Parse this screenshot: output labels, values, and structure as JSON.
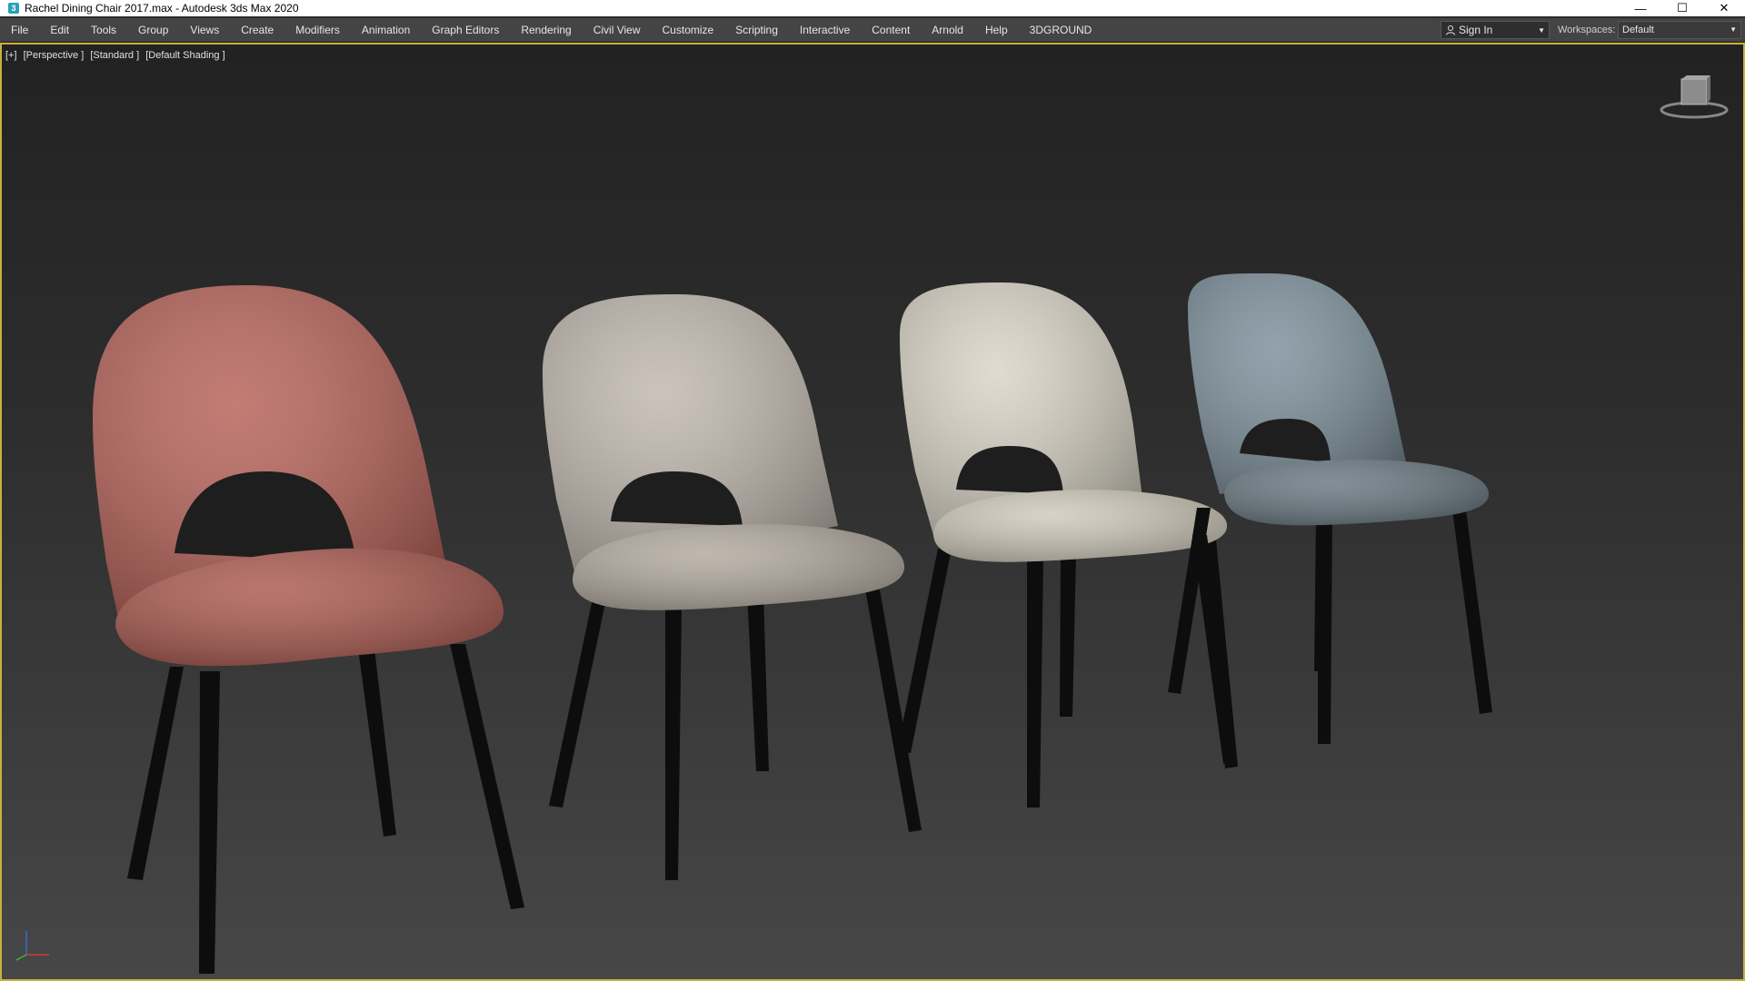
{
  "window": {
    "app_icon_glyph": "3",
    "title": "Rachel Dining Chair 2017.max - Autodesk 3ds Max 2020",
    "controls": {
      "minimize": "—",
      "maximize": "☐",
      "close": "✕"
    }
  },
  "menu": {
    "items": [
      "File",
      "Edit",
      "Tools",
      "Group",
      "Views",
      "Create",
      "Modifiers",
      "Animation",
      "Graph Editors",
      "Rendering",
      "Civil View",
      "Customize",
      "Scripting",
      "Interactive",
      "Content",
      "Arnold",
      "Help",
      "3DGROUND"
    ],
    "sign_in": "Sign In",
    "workspaces_label": "Workspaces:",
    "workspace_value": "Default"
  },
  "viewport": {
    "labels": [
      "[+]",
      "[Perspective ]",
      "[Standard ]",
      "[Default Shading ]"
    ],
    "active_border_color": "#c7b23a",
    "objects": [
      {
        "name": "chair-terracotta",
        "color": "#b45f55"
      },
      {
        "name": "chair-taupe",
        "color": "#bfb6ad"
      },
      {
        "name": "chair-cream",
        "color": "#d8d3c5"
      },
      {
        "name": "chair-bluegray",
        "color": "#7a8d99"
      }
    ],
    "leg_color": "#0d0d0d"
  },
  "icons": {
    "user": "user-icon",
    "viewcube": "viewcube-icon",
    "axis": "axis-tripod-icon"
  }
}
